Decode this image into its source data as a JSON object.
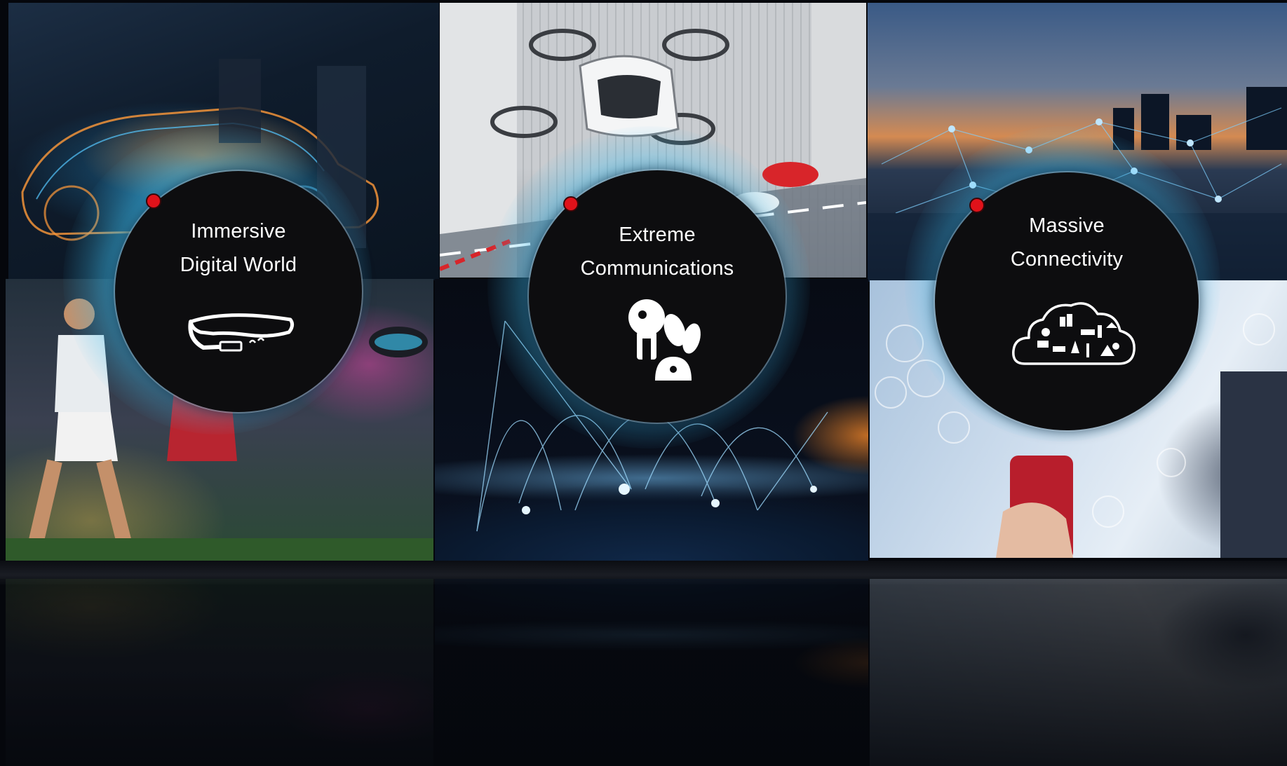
{
  "panels": [
    {
      "id": "immersive",
      "line1": "Immersive",
      "line2": "Digital World",
      "icon": "smart-glasses-icon"
    },
    {
      "id": "extreme",
      "line1": "Extreme",
      "line2": "Communications",
      "icon": "robots-icon"
    },
    {
      "id": "massive",
      "line1": "Massive",
      "line2": "Connectivity",
      "icon": "iot-cloud-icon"
    }
  ],
  "colors": {
    "accent_dot": "#e0121a",
    "glow": "#3cbef0",
    "circle": "#0d0d0f"
  }
}
